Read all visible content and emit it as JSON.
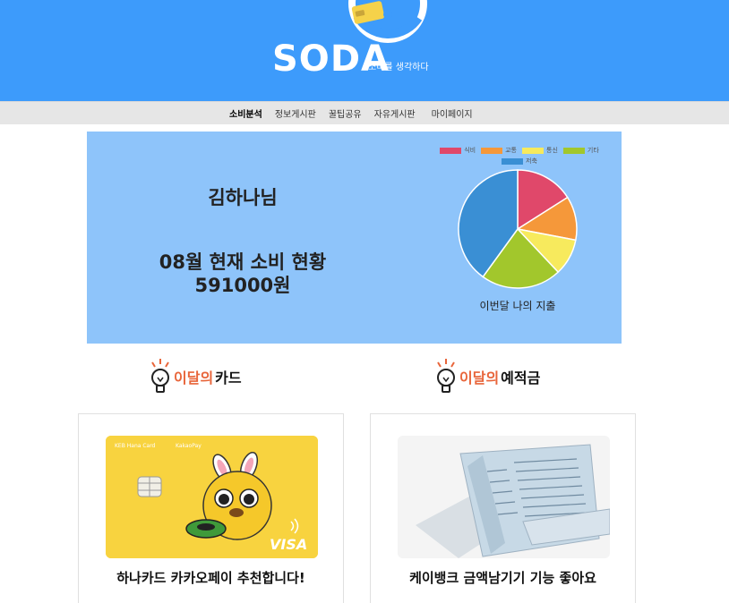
{
  "header": {
    "logo_text": "SODA",
    "tagline": "소비를 생각하다",
    "bg_color": "#3d9bfb"
  },
  "nav": {
    "items": [
      {
        "label": "소비분석",
        "active": true
      },
      {
        "label": "정보게시판",
        "active": false
      },
      {
        "label": "꿀팁공유",
        "active": false
      },
      {
        "label": "자유게시판",
        "active": false
      },
      {
        "label": "마이페이지",
        "active": false
      }
    ]
  },
  "summary": {
    "user_name": "김하나님",
    "status_title": "08월 현재 소비 현황",
    "status_amount": "591000원"
  },
  "chart_data": {
    "type": "pie",
    "title": "",
    "caption": "이번달 나의 지출",
    "categories": [
      "식비",
      "교통",
      "통신",
      "기타",
      "저축"
    ],
    "values": [
      0.16,
      0.12,
      0.1,
      0.22,
      0.4
    ],
    "colors": [
      "#e0486a",
      "#f5983a",
      "#f7ea5d",
      "#a2c72c",
      "#3a8fd4"
    ],
    "legend_position": "top"
  },
  "sections": {
    "card": {
      "accent": "이달의",
      "main": "카드"
    },
    "deposit": {
      "accent": "이달의",
      "main": "예적금"
    }
  },
  "cards": {
    "hana": {
      "caption": "하나카드 카카오페이 추천합니다!",
      "brand": "KEB Hana Card",
      "partner": "KakaoPay",
      "network": "VISA"
    },
    "kbank": {
      "caption": "케이뱅크 금액남기기 기능 좋아요"
    }
  }
}
